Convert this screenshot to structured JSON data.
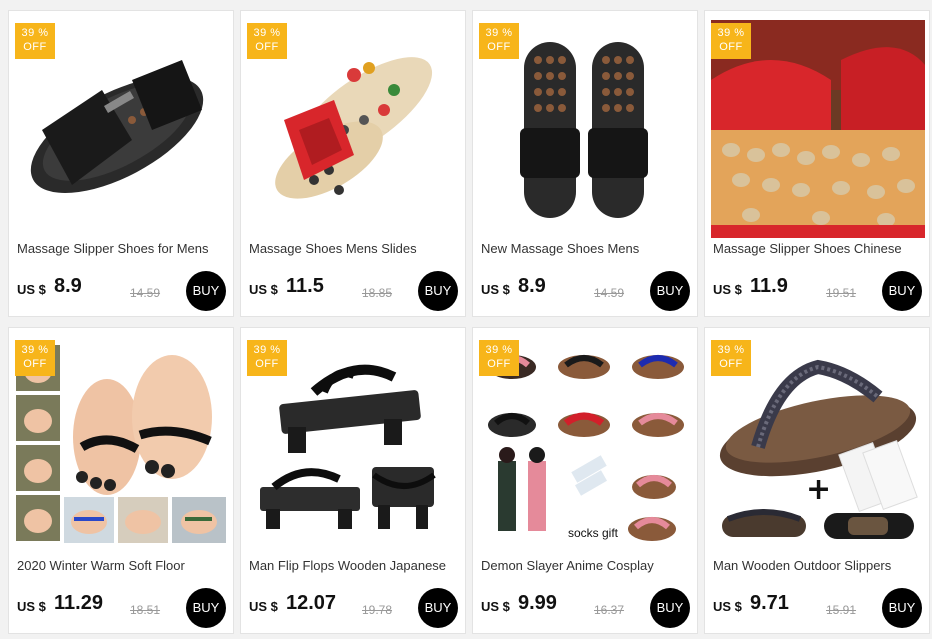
{
  "badge_color": "#f7b51a",
  "products": [
    {
      "discount": "39 %",
      "discount_suffix": "OFF",
      "title": "Massage Slipper Shoes for Mens",
      "currency": "US $",
      "price": "8.9",
      "original_price": "14.59",
      "buy_label": "BUY",
      "image": "black-massage-slipper"
    },
    {
      "discount": "39 %",
      "discount_suffix": "OFF",
      "title": "Massage Shoes Mens Slides",
      "currency": "US $",
      "price": "11.5",
      "original_price": "18.85",
      "buy_label": "BUY",
      "image": "red-massage-slide"
    },
    {
      "discount": "39 %",
      "discount_suffix": "OFF",
      "title": "New Massage Shoes Mens",
      "currency": "US $",
      "price": "8.9",
      "original_price": "14.59",
      "buy_label": "BUY",
      "image": "black-massage-slide-pair"
    },
    {
      "discount": "39 %",
      "discount_suffix": "OFF",
      "title": "Massage Slipper Shoes Chinese",
      "currency": "US $",
      "price": "11.9",
      "original_price": "19.51",
      "buy_label": "BUY",
      "image": "stone-massage-slipper-closeup"
    },
    {
      "discount": "39 %",
      "discount_suffix": "OFF",
      "title": "2020 Winter Warm Soft Floor",
      "currency": "US $",
      "price": "11.29",
      "original_price": "18.51",
      "buy_label": "BUY",
      "image": "plush-feet-slippers"
    },
    {
      "discount": "39 %",
      "discount_suffix": "OFF",
      "title": "Man Flip Flops Wooden Japanese",
      "currency": "US $",
      "price": "12.07",
      "original_price": "19.78",
      "buy_label": "BUY",
      "image": "black-wooden-geta"
    },
    {
      "discount": "39 %",
      "discount_suffix": "OFF",
      "title": "Demon Slayer Anime Cosplay",
      "currency": "US $",
      "price": "9.99",
      "original_price": "16.37",
      "buy_label": "BUY",
      "image": "anime-geta-set",
      "image_caption": "socks gift"
    },
    {
      "discount": "39 %",
      "discount_suffix": "OFF",
      "title": "Man Wooden Outdoor Slippers",
      "currency": "US $",
      "price": "9.71",
      "original_price": "15.91",
      "buy_label": "BUY",
      "image": "wooden-geta-with-socks"
    }
  ]
}
